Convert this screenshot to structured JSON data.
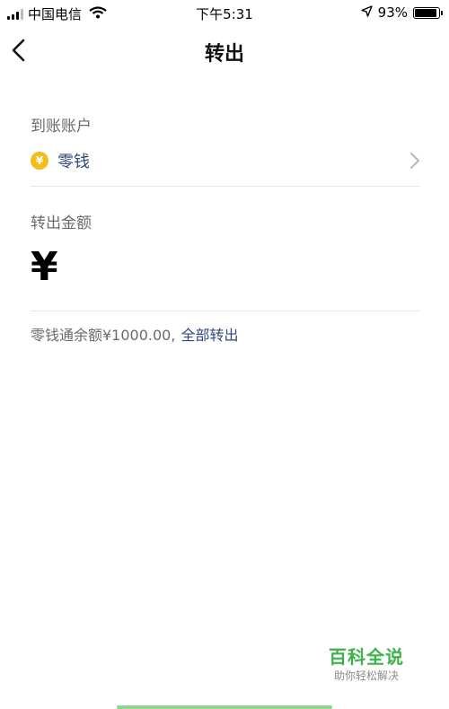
{
  "status_bar": {
    "carrier": "中国电信",
    "time": "下午5:31",
    "battery_percent": "93%",
    "battery_level": 0.93
  },
  "nav": {
    "title": "转出",
    "back_icon": "chevron-left-icon"
  },
  "destination": {
    "label": "到账账户",
    "account_name": "零钱",
    "account_icon": "coin-yuan-icon",
    "coin_glyph": "¥"
  },
  "amount": {
    "label": "转出金额",
    "currency_symbol": "¥",
    "value": ""
  },
  "balance": {
    "text": "零钱通余额¥1000.00,",
    "action_label": "全部转出"
  },
  "watermark": {
    "title": "百科全说",
    "subtitle": "助你轻松解决"
  },
  "colors": {
    "accent_blue": "#2f4a7a",
    "coin_yellow": "#f1be1a",
    "watermark_green": "#3fb24b"
  }
}
